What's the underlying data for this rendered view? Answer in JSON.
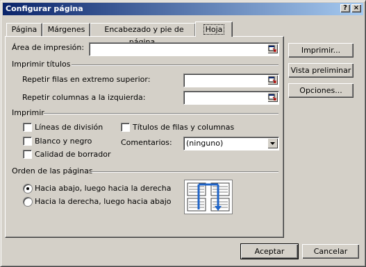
{
  "window": {
    "title": "Configurar página",
    "help_label": "?",
    "close_label": "×"
  },
  "tabs": [
    {
      "label": "Página"
    },
    {
      "label": "Márgenes"
    },
    {
      "label": "Encabezado y pie de página"
    },
    {
      "label": "Hoja"
    }
  ],
  "print_area": {
    "label": "Área de impresión:",
    "value": ""
  },
  "print_titles": {
    "group_label": "Imprimir títulos",
    "rows_label": "Repetir filas en extremo superior:",
    "rows_value": "",
    "cols_label": "Repetir columnas a la izquierda:",
    "cols_value": ""
  },
  "print": {
    "group_label": "Imprimir",
    "gridlines": "Líneas de división",
    "black_white": "Blanco y negro",
    "draft": "Calidad de borrador",
    "headings": "Títulos de filas y columnas",
    "comments_label": "Comentarios:",
    "comments_value": "(ninguno)"
  },
  "page_order": {
    "group_label": "Orden de las páginas",
    "down_then_over": "Hacia abajo, luego hacia la derecha",
    "over_then_down": "Hacia la derecha, luego hacia abajo",
    "selected": "down_then_over"
  },
  "side_buttons": {
    "print": "Imprimir...",
    "preview": "Vista preliminar",
    "options": "Opciones..."
  },
  "footer": {
    "ok": "Aceptar",
    "cancel": "Cancelar"
  },
  "colors": {
    "title_start": "#0a246a",
    "title_end": "#a6caf0",
    "preview_arrow": "#1f64c8"
  }
}
